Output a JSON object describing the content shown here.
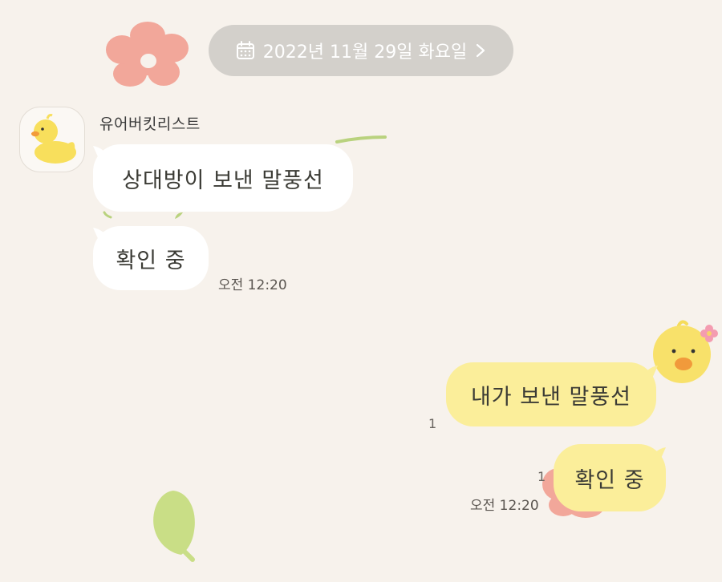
{
  "date_divider": {
    "label": "2022년 11월 29일 화요일"
  },
  "received": {
    "sender_name": "유어버킷리스트",
    "messages": [
      {
        "text": "상대방이 보낸 말풍선"
      },
      {
        "text": "확인 중"
      }
    ],
    "time": "오전 12:20"
  },
  "sent": {
    "messages": [
      {
        "text": "내가 보낸 말풍선",
        "unread": "1"
      },
      {
        "text": "확인 중",
        "unread": "1"
      }
    ],
    "time": "오전 12:20"
  },
  "colors": {
    "background": "#f7f2ec",
    "date_pill": "#d3d0cb",
    "received_bubble": "#ffffff",
    "sent_bubble": "#fbee9a"
  },
  "icons": {
    "date": "calendar-icon",
    "date_arrow": "chevron-right-icon"
  }
}
